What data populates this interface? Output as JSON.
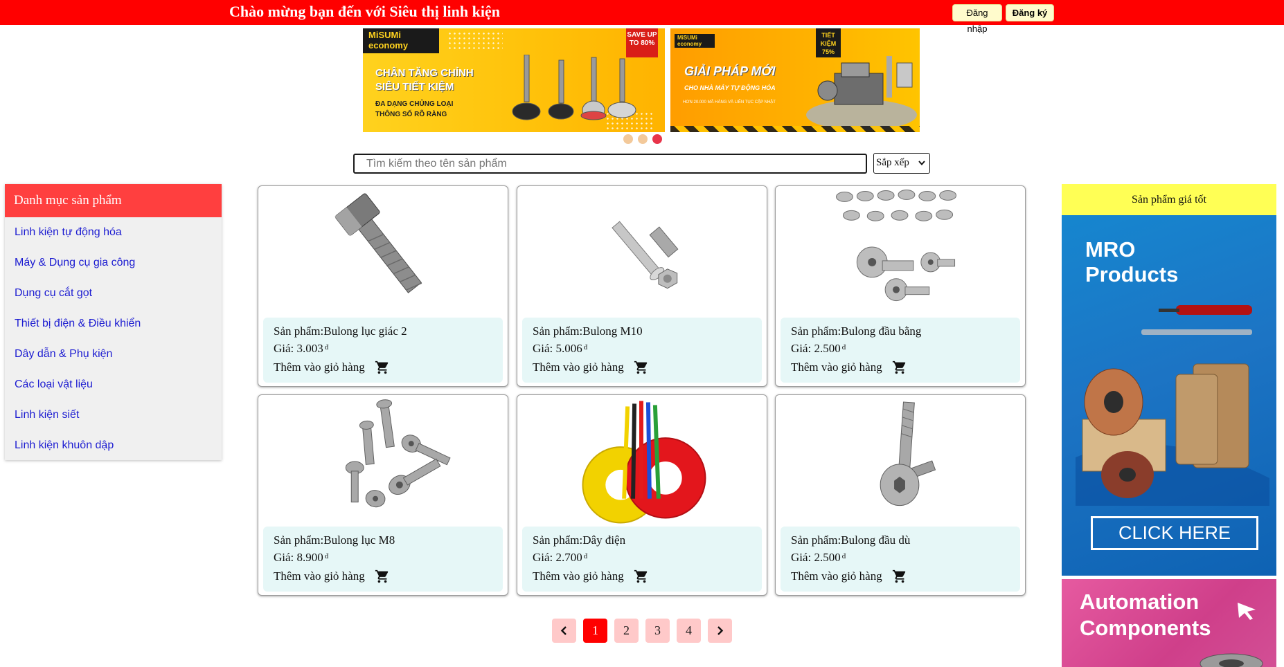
{
  "topbar": {
    "welcome": "Chào mừng bạn đến với Siêu thị linh kiện",
    "login_label": "Đăng nhập",
    "register_label": "Đăng ký",
    "color": "#ff0000"
  },
  "banners": [
    {
      "brand": "MiSUMi economy",
      "badge": "SAVE UP TO 80%",
      "headline_1": "CHÂN TĂNG CHỈNH",
      "headline_2": "SIÊU TIẾT KIỆM",
      "sub_1": "ĐA DẠNG CHỦNG LOẠI",
      "sub_2": "THÔNG SỐ RÕ RÀNG"
    },
    {
      "brand": "MiSUMi economy",
      "badge": "TIẾT KIỆM 75%",
      "headline": "GIẢI PHÁP MỚI",
      "sub": "CHO NHÀ MÁY TỰ ĐỘNG HÓA",
      "note": "HƠN 20.000 MÃ HÀNG VÀ LIÊN TỤC CẬP NHẬT"
    }
  ],
  "slider": {
    "dots": 3,
    "active_index": 2
  },
  "search": {
    "placeholder": "Tìm kiếm theo tên sản phẩm",
    "value": ""
  },
  "sort": {
    "label": "Sắp xếp",
    "icon": "chevron-down-icon"
  },
  "sidebar": {
    "title": "Danh mục sản phẩm",
    "items": [
      {
        "label": "Linh kiện tự động hóa"
      },
      {
        "label": "Máy & Dụng cụ gia công"
      },
      {
        "label": "Dụng cụ cắt gọt"
      },
      {
        "label": "Thiết bị điện & Điều khiển"
      },
      {
        "label": "Dây dẫn & Phụ kiện"
      },
      {
        "label": "Các loại vật liệu"
      },
      {
        "label": "Linh kiện siết"
      },
      {
        "label": "Linh kiện khuôn dập"
      }
    ]
  },
  "products": [
    {
      "name": "Sản phẩm:Bulong lục giác 2",
      "price": "Giá: 3.003",
      "currency": "đ",
      "cart_label": "Thêm vào giỏ hàng",
      "image": "hex-bolt"
    },
    {
      "name": "Sản phẩm:Bulong M10",
      "price": "Giá: 5.006",
      "currency": "đ",
      "cart_label": "Thêm vào giỏ hàng",
      "image": "bolt-nut"
    },
    {
      "name": "Sản phẩm:Bulong đầu bằng",
      "price": "Giá: 2.500",
      "currency": "đ",
      "cart_label": "Thêm vào giỏ hàng",
      "image": "button-head-bolts"
    },
    {
      "name": "Sản phẩm:Bulong lục M8",
      "price": "Giá: 8.900",
      "currency": "đ",
      "cart_label": "Thêm vào giỏ hàng",
      "image": "countersunk-bolts"
    },
    {
      "name": "Sản phẩm:Dây điện",
      "price": "Giá: 2.700",
      "currency": "đ",
      "cart_label": "Thêm vào giỏ hàng",
      "image": "electric-wires"
    },
    {
      "name": "Sản phẩm:Bulong đầu dù",
      "price": "Giá: 2.500",
      "currency": "đ",
      "cart_label": "Thêm vào giỏ hàng",
      "image": "socket-cap-bolt"
    }
  ],
  "pagination": {
    "prev_icon": "chevron-left-icon",
    "next_icon": "chevron-right-icon",
    "pages": [
      "1",
      "2",
      "3",
      "4"
    ],
    "current": "1"
  },
  "right_panel": {
    "title": "Sản phẩm giá tốt",
    "ad_mro": {
      "title_1": "MRO",
      "title_2": "Products",
      "button": "CLICK HERE"
    },
    "ad_auto": {
      "title_1": "Automation",
      "title_2": "Components"
    }
  }
}
